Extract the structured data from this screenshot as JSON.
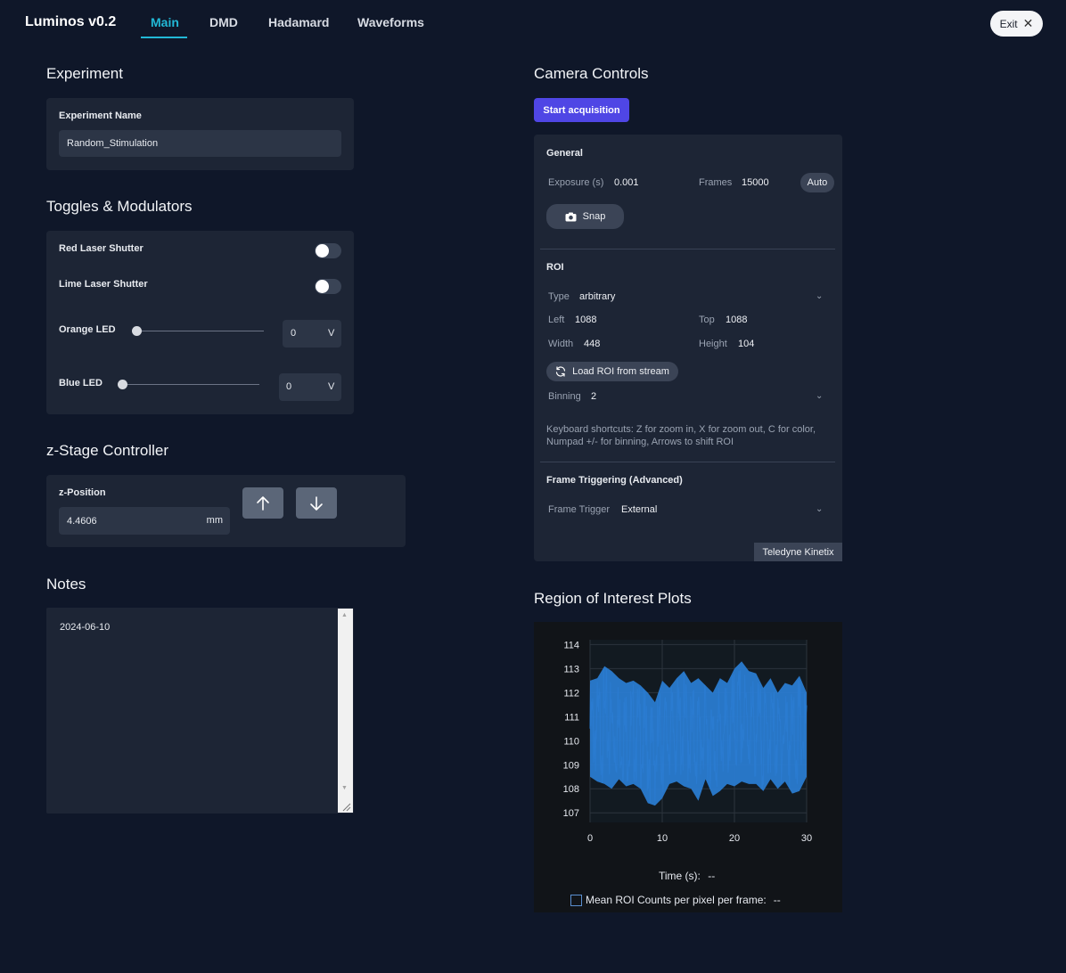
{
  "app": {
    "title": "Luminos v0.2",
    "exit_label": "Exit"
  },
  "tabs": [
    {
      "label": "Main",
      "active": true
    },
    {
      "label": "DMD"
    },
    {
      "label": "Hadamard"
    },
    {
      "label": "Waveforms"
    }
  ],
  "experiment": {
    "title": "Experiment",
    "name_label": "Experiment Name",
    "name_value": "Random_Stimulation"
  },
  "toggles": {
    "title": "Toggles & Modulators",
    "red_laser_label": "Red Laser Shutter",
    "red_laser_on": false,
    "lime_laser_label": "Lime Laser Shutter",
    "lime_laser_on": false,
    "orange_led_label": "Orange LED",
    "orange_led_value": "0",
    "orange_led_unit": "V",
    "blue_led_label": "Blue LED",
    "blue_led_value": "0",
    "blue_led_unit": "V"
  },
  "zstage": {
    "title": "z-Stage Controller",
    "position_label": "z-Position",
    "position_value": "4.4606",
    "unit": "mm",
    "up_icon": "arrow-up-icon",
    "down_icon": "arrow-down-icon"
  },
  "notes": {
    "title": "Notes",
    "text": "2024-06-10"
  },
  "camera": {
    "title": "Camera Controls",
    "start_label": "Start acquisition",
    "general_title": "General",
    "exposure_label": "Exposure (s)",
    "exposure_value": "0.001",
    "frames_label": "Frames",
    "frames_value": "15000",
    "auto_label": "Auto",
    "snap_label": "Snap",
    "roi_title": "ROI",
    "type_label": "Type",
    "type_value": "arbitrary",
    "left_label": "Left",
    "left_value": "1088",
    "top_label": "Top",
    "top_value": "1088",
    "width_label": "Width",
    "width_value": "448",
    "height_label": "Height",
    "height_value": "104",
    "load_roi_label": "Load ROI from stream",
    "binning_label": "Binning",
    "binning_value": "2",
    "shortcuts_line1": "Keyboard shortcuts: Z for zoom in, X for zoom out, C for color,",
    "shortcuts_line2": "Numpad +/- for binning, Arrows to shift ROI",
    "trigger_title": "Frame Triggering (Advanced)",
    "trigger_label": "Frame Trigger",
    "trigger_value": "External",
    "camera_model": "Teledyne Kinetix"
  },
  "roi_plots": {
    "title": "Region of Interest Plots",
    "time_label": "Time (s):",
    "time_value": "--",
    "mean_label": "Mean ROI Counts per pixel per frame:",
    "mean_value": "--"
  },
  "chart_data": {
    "type": "line",
    "x_ticks": [
      "0",
      "10",
      "20",
      "30"
    ],
    "y_ticks": [
      "107",
      "108",
      "109",
      "110",
      "111",
      "112",
      "113",
      "114"
    ],
    "xlim": [
      0,
      30
    ],
    "ylim": [
      106.6,
      114.2
    ],
    "series": [
      {
        "color": "#2a7bd0",
        "x": [
          0,
          1,
          2,
          3,
          4,
          5,
          6,
          7,
          8,
          9,
          10,
          11,
          12,
          13,
          14,
          15,
          16,
          17,
          18,
          19,
          20,
          21,
          22,
          23,
          24,
          25,
          26,
          27,
          28,
          29,
          30
        ],
        "mean": [
          110.5,
          110.6,
          110.8,
          110.7,
          110.6,
          110.5,
          110.4,
          110.3,
          110.0,
          109.8,
          109.9,
          110.2,
          110.4,
          110.6,
          110.6,
          110.4,
          110.2,
          110.1,
          110.3,
          110.5,
          110.6,
          110.7,
          110.6,
          110.5,
          110.3,
          110.2,
          110.2,
          110.4,
          110.5,
          110.4,
          110.3
        ],
        "min": [
          108.5,
          108.3,
          108.2,
          108.0,
          108.4,
          108.1,
          108.2,
          108.0,
          107.4,
          107.3,
          107.6,
          108.2,
          108.3,
          108.1,
          108.0,
          107.5,
          108.4,
          107.7,
          107.9,
          108.2,
          108.1,
          108.3,
          108.2,
          108.2,
          107.9,
          108.4,
          108.0,
          108.3,
          107.8,
          107.9,
          108.5
        ],
        "max": [
          112.5,
          112.6,
          113.1,
          112.9,
          112.6,
          112.4,
          112.5,
          112.3,
          112.0,
          111.6,
          112.5,
          112.2,
          112.6,
          112.9,
          112.4,
          112.6,
          112.3,
          112.0,
          112.6,
          112.4,
          113.0,
          113.3,
          112.9,
          112.8,
          112.2,
          112.6,
          112.0,
          112.4,
          112.3,
          112.7,
          112.0
        ]
      }
    ]
  }
}
